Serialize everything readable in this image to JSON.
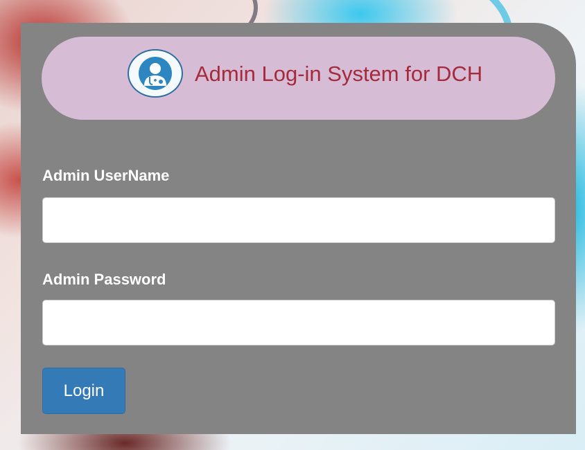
{
  "header": {
    "title": "Admin Log-in System for DCH",
    "logo_icon": "doctor-avatar-icon"
  },
  "form": {
    "username_label": "Admin UserName",
    "username_value": "",
    "password_label": "Admin Password",
    "password_value": "",
    "login_label": "Login"
  },
  "colors": {
    "panel_bg": "#848484",
    "header_bg": "#d7bcd6",
    "title_color": "#a52a3c",
    "button_bg": "#337ab7",
    "logo_accent": "#2e6da4"
  }
}
